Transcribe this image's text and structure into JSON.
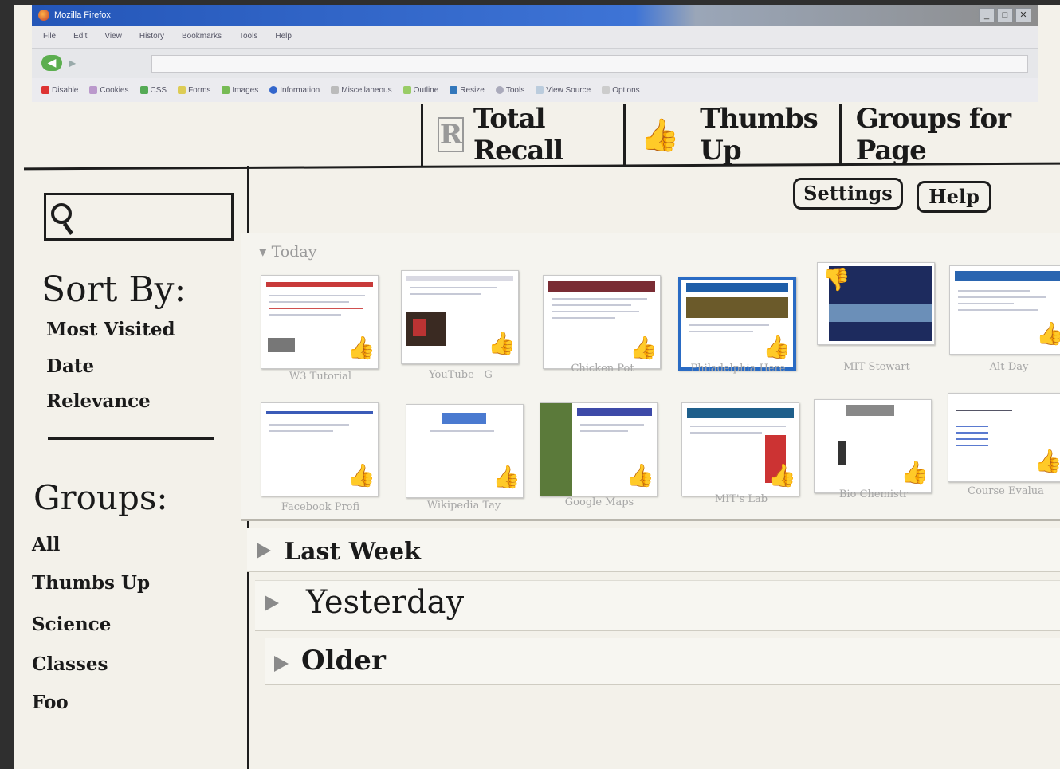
{
  "browser": {
    "title": "Mozilla Firefox",
    "menu": [
      "File",
      "Edit",
      "View",
      "History",
      "Bookmarks",
      "Tools",
      "Help"
    ],
    "devtoolbar": [
      "Disable",
      "Cookies",
      "CSS",
      "Forms",
      "Images",
      "Information",
      "Miscellaneous",
      "Outline",
      "Resize",
      "Tools",
      "View Source",
      "Options"
    ]
  },
  "tabs": {
    "total_recall": "Total Recall",
    "thumbs_up": "Thumbs Up",
    "groups_for_page": "Groups for Page"
  },
  "header_buttons": {
    "settings": "Settings",
    "help": "Help"
  },
  "sidebar": {
    "sort_title": "Sort By:",
    "sort_options": [
      "Most Visited",
      "Date",
      "Relevance"
    ],
    "groups_title": "Groups:",
    "groups": [
      "All",
      "Thumbs Up",
      "Science",
      "Classes",
      "Foo"
    ]
  },
  "today": {
    "label": "Today",
    "row1_captions": [
      "W3 Tutorial",
      "YouTube - G",
      "Chicken Pot",
      "Philadelphia Here",
      "MIT Stewart",
      "Alt-Day"
    ],
    "row2_captions": [
      "Facebook Profi",
      "Wikipedia Tay",
      "Google Maps",
      "MIT's Lab",
      "Bio Chemistr",
      "Course Evalua"
    ]
  },
  "sections": {
    "last_week": "Last Week",
    "yesterday": "Yesterday",
    "older": "Older"
  },
  "colors": {
    "paper": "#f3f1ea",
    "ink": "#1d1d1d",
    "firefox_blue": "#2456b8"
  }
}
